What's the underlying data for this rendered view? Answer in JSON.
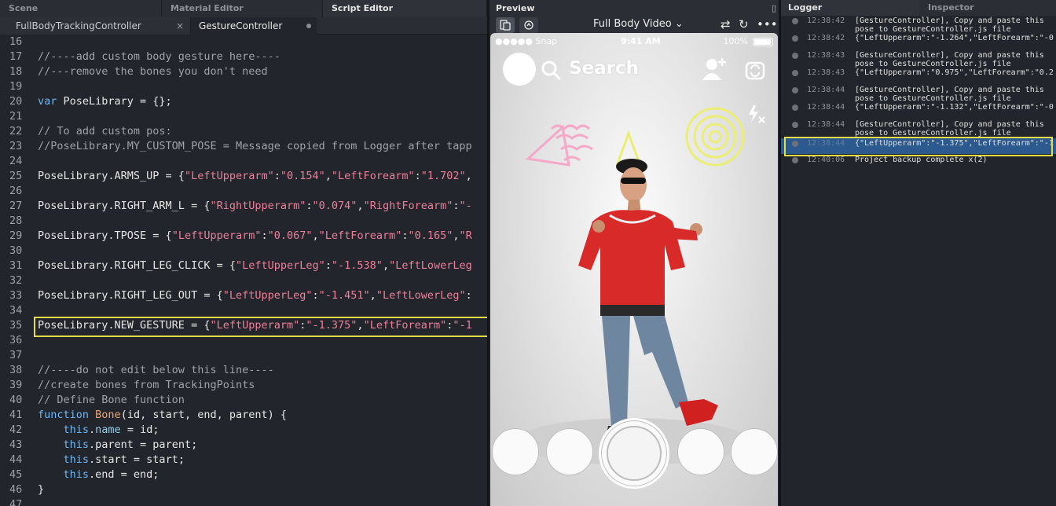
{
  "panels": {
    "scene_tab": "Scene",
    "material_tab": "Material Editor",
    "script_tab": "Script Editor"
  },
  "editor": {
    "files": [
      {
        "name": "FullBodyTrackingController",
        "close": "×"
      },
      {
        "name": "GestureController"
      }
    ],
    "lines": [
      {
        "n": "16",
        "segs": []
      },
      {
        "n": "17",
        "segs": [
          {
            "c": "comment",
            "t": "//----add custom body gesture here----"
          }
        ]
      },
      {
        "n": "18",
        "segs": [
          {
            "c": "comment",
            "t": "//---remove the bones you don't need"
          }
        ]
      },
      {
        "n": "19",
        "segs": []
      },
      {
        "n": "20",
        "segs": [
          {
            "c": "kw",
            "t": "var"
          },
          {
            "c": "plain",
            "t": " PoseLibrary = {};"
          }
        ]
      },
      {
        "n": "21",
        "segs": []
      },
      {
        "n": "22",
        "segs": [
          {
            "c": "comment",
            "t": "// To add custom pos:"
          }
        ]
      },
      {
        "n": "23",
        "segs": [
          {
            "c": "comment",
            "t": "//PoseLibrary.MY_CUSTOM_POSE = Message copied from Logger after tapp"
          }
        ]
      },
      {
        "n": "24",
        "segs": []
      },
      {
        "n": "25",
        "segs": [
          {
            "c": "plain",
            "t": "PoseLibrary.ARMS_UP = {"
          },
          {
            "c": "str",
            "t": "\"LeftUpperarm\""
          },
          {
            "c": "plain",
            "t": ":"
          },
          {
            "c": "str",
            "t": "\"0.154\""
          },
          {
            "c": "plain",
            "t": ","
          },
          {
            "c": "str",
            "t": "\"LeftForearm\""
          },
          {
            "c": "plain",
            "t": ":"
          },
          {
            "c": "str",
            "t": "\"1.702\""
          },
          {
            "c": "plain",
            "t": ","
          }
        ]
      },
      {
        "n": "26",
        "segs": []
      },
      {
        "n": "27",
        "segs": [
          {
            "c": "plain",
            "t": "PoseLibrary.RIGHT_ARM_L = {"
          },
          {
            "c": "str",
            "t": "\"RightUpperarm\""
          },
          {
            "c": "plain",
            "t": ":"
          },
          {
            "c": "str",
            "t": "\"0.074\""
          },
          {
            "c": "plain",
            "t": ","
          },
          {
            "c": "str",
            "t": "\"RightForearm\""
          },
          {
            "c": "plain",
            "t": ":"
          },
          {
            "c": "str",
            "t": "\"-"
          }
        ]
      },
      {
        "n": "28",
        "segs": []
      },
      {
        "n": "29",
        "segs": [
          {
            "c": "plain",
            "t": "PoseLibrary.TPOSE = {"
          },
          {
            "c": "str",
            "t": "\"LeftUpperarm\""
          },
          {
            "c": "plain",
            "t": ":"
          },
          {
            "c": "str",
            "t": "\"0.067\""
          },
          {
            "c": "plain",
            "t": ","
          },
          {
            "c": "str",
            "t": "\"LeftForearm\""
          },
          {
            "c": "plain",
            "t": ":"
          },
          {
            "c": "str",
            "t": "\"0.165\""
          },
          {
            "c": "plain",
            "t": ","
          },
          {
            "c": "str",
            "t": "\"R"
          }
        ]
      },
      {
        "n": "30",
        "segs": []
      },
      {
        "n": "31",
        "segs": [
          {
            "c": "plain",
            "t": "PoseLibrary.RIGHT_LEG_CLICK = {"
          },
          {
            "c": "str",
            "t": "\"LeftUpperLeg\""
          },
          {
            "c": "plain",
            "t": ":"
          },
          {
            "c": "str",
            "t": "\"-1.538\""
          },
          {
            "c": "plain",
            "t": ","
          },
          {
            "c": "str",
            "t": "\"LeftLowerLeg"
          }
        ]
      },
      {
        "n": "32",
        "segs": []
      },
      {
        "n": "33",
        "segs": [
          {
            "c": "plain",
            "t": "PoseLibrary.RIGHT_LEG_OUT = {"
          },
          {
            "c": "str",
            "t": "\"LeftUpperLeg\""
          },
          {
            "c": "plain",
            "t": ":"
          },
          {
            "c": "str",
            "t": "\"-1.451\""
          },
          {
            "c": "plain",
            "t": ","
          },
          {
            "c": "str",
            "t": "\"LeftLowerLeg\""
          },
          {
            "c": "plain",
            "t": ":"
          }
        ]
      },
      {
        "n": "34",
        "segs": []
      },
      {
        "n": "35",
        "segs": [
          {
            "c": "plain",
            "t": "PoseLibrary.NEW_GESTURE = {"
          },
          {
            "c": "str",
            "t": "\"LeftUpperarm\""
          },
          {
            "c": "plain",
            "t": ":"
          },
          {
            "c": "str",
            "t": "\"-1.375\""
          },
          {
            "c": "plain",
            "t": ","
          },
          {
            "c": "str",
            "t": "\"LeftForearm\""
          },
          {
            "c": "plain",
            "t": ":"
          },
          {
            "c": "str",
            "t": "\"-1"
          }
        ]
      },
      {
        "n": "36",
        "segs": []
      },
      {
        "n": "37",
        "segs": []
      },
      {
        "n": "38",
        "segs": [
          {
            "c": "comment",
            "t": "//----do not edit below this line----"
          }
        ]
      },
      {
        "n": "39",
        "segs": [
          {
            "c": "comment",
            "t": "//create bones from TrackingPoints"
          }
        ]
      },
      {
        "n": "40",
        "segs": [
          {
            "c": "comment",
            "t": "// Define Bone function"
          }
        ]
      },
      {
        "n": "41",
        "segs": [
          {
            "c": "kw",
            "t": "function"
          },
          {
            "c": "plain",
            "t": " "
          },
          {
            "c": "fn",
            "t": "Bone"
          },
          {
            "c": "plain",
            "t": "(id, start, end, parent) {"
          }
        ]
      },
      {
        "n": "42",
        "segs": [
          {
            "c": "plain",
            "t": "    "
          },
          {
            "c": "kw",
            "t": "this"
          },
          {
            "c": "plain",
            "t": "."
          },
          {
            "c": "prop",
            "t": "name"
          },
          {
            "c": "plain",
            "t": " = id;"
          }
        ]
      },
      {
        "n": "43",
        "segs": [
          {
            "c": "plain",
            "t": "    "
          },
          {
            "c": "kw",
            "t": "this"
          },
          {
            "c": "plain",
            "t": ".parent = parent;"
          }
        ]
      },
      {
        "n": "44",
        "segs": [
          {
            "c": "plain",
            "t": "    "
          },
          {
            "c": "kw",
            "t": "this"
          },
          {
            "c": "plain",
            "t": ".start = start;"
          }
        ]
      },
      {
        "n": "45",
        "segs": [
          {
            "c": "plain",
            "t": "    "
          },
          {
            "c": "kw",
            "t": "this"
          },
          {
            "c": "plain",
            "t": ".end = end;"
          }
        ]
      },
      {
        "n": "46",
        "segs": [
          {
            "c": "plain",
            "t": "}"
          }
        ]
      },
      {
        "n": "47",
        "segs": []
      }
    ]
  },
  "preview": {
    "title": "Preview",
    "video_select": "Full Body Video ⌄",
    "status": {
      "carrier": "●●●●● Snap",
      "time": "9:41 AM",
      "battery": "100%"
    },
    "search_label": "Search"
  },
  "logger": {
    "tab": "Logger",
    "inspector_tab": "Inspector",
    "entries": [
      {
        "time": "12:38:42",
        "msg": "[GestureController], Copy and paste this\npose to GestureController.js file"
      },
      {
        "time": "12:38:42",
        "msg": "{\"LeftUpperarm\":\"-1.264\",\"LeftForearm\":\"-0"
      },
      {
        "time": "12:38:43",
        "msg": "[GestureController], Copy and paste this\npose to GestureController.js file"
      },
      {
        "time": "12:38:43",
        "msg": "{\"LeftUpperarm\":\"0.975\",\"LeftForearm\":\"0.2"
      },
      {
        "time": "12:38:44",
        "msg": "[GestureController], Copy and paste this\npose to GestureController.js file"
      },
      {
        "time": "12:38:44",
        "msg": "{\"LeftUpperarm\":\"-1.132\",\"LeftForearm\":\"-0"
      },
      {
        "time": "12:38:44",
        "msg": "[GestureController], Copy and paste this\npose to GestureController.js file"
      },
      {
        "time": "12:38:44",
        "msg": "{\"LeftUpperarm\":\"-1.375\",\"LeftForearm\":\"-1"
      },
      {
        "time": "12:40:06",
        "msg": "Project backup complete x(2)"
      }
    ],
    "selected_index": 7
  },
  "colors": {
    "highlight": "#e4dd4a",
    "string": "#ee7f9a",
    "keyword": "#6fb7f5",
    "comment": "#9ea3ab",
    "selection": "#2c5a8e"
  }
}
